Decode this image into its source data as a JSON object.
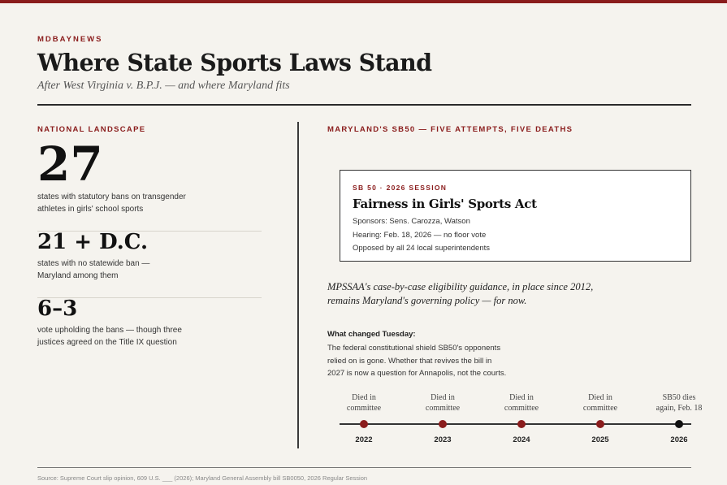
{
  "kicker": "MDBAYNEWS",
  "title": "Where State Sports Laws Stand",
  "subtitle": "After West Virginia v. B.P.J. — and where Maryland fits",
  "left": {
    "label": "NATIONAL LANDSCAPE",
    "stats": [
      {
        "value": "27",
        "desc_1": "states with statutory bans on transgender",
        "desc_2": "athletes in girls' school sports"
      },
      {
        "value": "21 + D.C.",
        "desc_1": "states with no statewide ban —",
        "desc_2": "Maryland among them"
      },
      {
        "value": "6–3",
        "desc_1": "vote upholding the bans — though three",
        "desc_2": "justices agreed on the Title IX question"
      }
    ]
  },
  "right": {
    "label": "MARYLAND'S SB50 — FIVE ATTEMPTS, FIVE DEATHS",
    "card": {
      "tag": "SB 50 · 2026 SESSION",
      "title": "Fairness in Girls' Sports Act",
      "line_1": "Sponsors: Sens. Carozza, Watson",
      "line_2": "Hearing: Feb. 18, 2026 — no floor vote",
      "line_3": "Opposed by all 24 local superintendents"
    },
    "quote_1": "MPSSAA's case-by-case eligibility guidance, in place since 2012,",
    "quote_2": "remains Maryland's governing policy — for now.",
    "changed_head": "What changed Tuesday:",
    "changed_1": "The federal constitutional shield SB50's opponents",
    "changed_2": "relied on is gone. Whether that revives the bill in",
    "changed_3": "2027 is now a question for Annapolis, not the courts.",
    "timeline": [
      {
        "label_1": "Died in",
        "label_2": "committee",
        "year": "2022"
      },
      {
        "label_1": "Died in",
        "label_2": "committee",
        "year": "2023"
      },
      {
        "label_1": "Died in",
        "label_2": "committee",
        "year": "2024"
      },
      {
        "label_1": "Died in",
        "label_2": "committee",
        "year": "2025"
      },
      {
        "label_1": "SB50 dies",
        "label_2": "again, Feb. 18",
        "year": "2026"
      }
    ]
  },
  "source": "Source: Supreme Court slip opinion, 609 U.S. ___ (2026); Maryland General Assembly bill SB0050, 2026 Regular Session",
  "colors": {
    "accent": "#8a1c1c",
    "background": "#f5f3ee",
    "ink": "#111111"
  }
}
